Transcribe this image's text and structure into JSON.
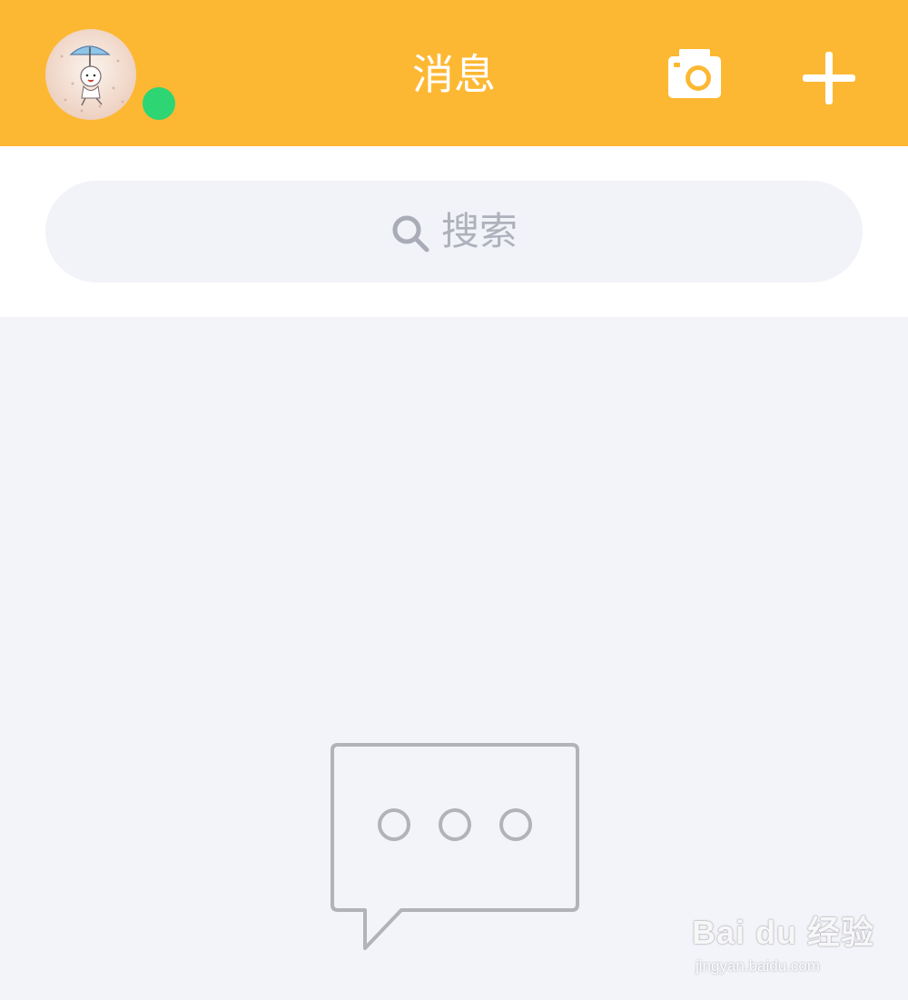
{
  "header": {
    "title": "消息",
    "background_color": "#fdb833",
    "online_status_color": "#2ed573",
    "icons": {
      "avatar": "user-avatar",
      "camera": "camera-icon",
      "add": "plus-icon"
    }
  },
  "search": {
    "placeholder": "搜索",
    "icon": "search-icon"
  },
  "main": {
    "background_color": "#f3f4f9",
    "empty_icon": "chat-bubble-icon"
  },
  "watermark": {
    "brand": "Bai du 经验",
    "url": "jingyan.baidu.com"
  }
}
